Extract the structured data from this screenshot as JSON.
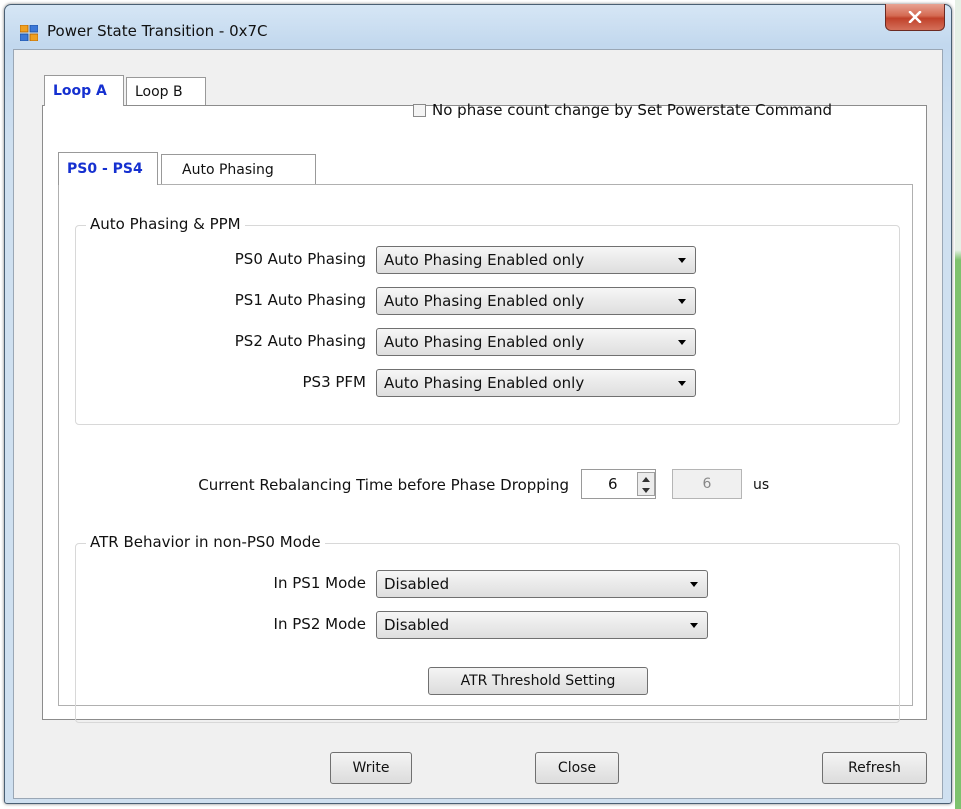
{
  "window": {
    "title": "Power State Transition - 0x7C"
  },
  "outer_tabs": [
    {
      "label": "Loop A",
      "active": true
    },
    {
      "label": "Loop B",
      "active": false
    }
  ],
  "no_phase_checkbox": {
    "label": "No phase count change by Set Powerstate Command",
    "checked": false
  },
  "inner_tabs": [
    {
      "label": "PS0 - PS4",
      "active": true
    },
    {
      "label": "Auto Phasing",
      "active": false
    }
  ],
  "auto_phasing_group": {
    "title": "Auto Phasing & PPM",
    "rows": [
      {
        "label": "PS0 Auto Phasing",
        "value": "Auto Phasing Enabled only"
      },
      {
        "label": "PS1 Auto Phasing",
        "value": "Auto Phasing Enabled only"
      },
      {
        "label": "PS2 Auto Phasing",
        "value": "Auto Phasing Enabled only"
      },
      {
        "label": "PS3 PFM",
        "value": "Auto Phasing Enabled only"
      }
    ]
  },
  "rebalancing": {
    "label": "Current Rebalancing Time before Phase Dropping",
    "value": "6",
    "readout": "6",
    "unit": "us"
  },
  "atr_group": {
    "title": "ATR Behavior in non-PS0 Mode",
    "rows": [
      {
        "label": "In PS1 Mode",
        "value": "Disabled"
      },
      {
        "label": "In PS2 Mode",
        "value": "Disabled"
      }
    ],
    "threshold_button": "ATR Threshold Setting"
  },
  "footer": {
    "write": "Write",
    "close": "Close",
    "refresh": "Refresh"
  },
  "colors": {
    "active_tab": "#1530d0",
    "close_button": "#c0412a"
  }
}
